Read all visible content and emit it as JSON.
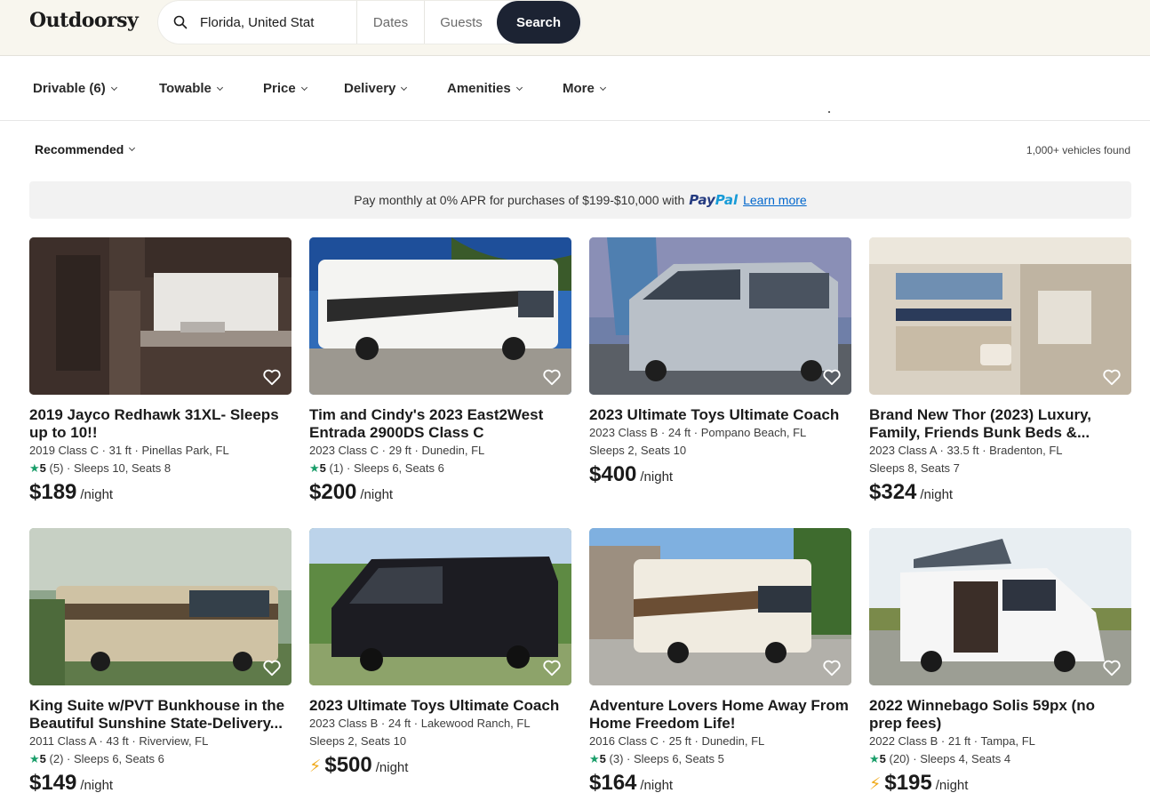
{
  "header": {
    "logo": "Outdoorsy",
    "search": {
      "location_value": "Florida, United Stat",
      "dates_label": "Dates",
      "guests_label": "Guests",
      "search_button": "Search"
    }
  },
  "filters": [
    {
      "label": "Drivable (6)"
    },
    {
      "label": "Towable"
    },
    {
      "label": "Price"
    },
    {
      "label": "Delivery"
    },
    {
      "label": "Amenities"
    },
    {
      "label": "More"
    }
  ],
  "sort": {
    "label": "Recommended",
    "count": "1,000+ vehicles found"
  },
  "banner": {
    "text": "Pay monthly at 0% APR for purchases of $199-$10,000 with",
    "paypal_a": "Pay",
    "paypal_b": "Pal",
    "learn_more": "Learn more"
  },
  "listings": [
    {
      "title": "2019 Jayco Redhawk 31XL- Sleeps up to 10!!",
      "meta": "2019 Class C · 31 ft · Pinellas Park, FL",
      "rating": "5",
      "reviews": "(5)",
      "sleeps": "Sleeps 10, Seats 8",
      "price": "$189",
      "per": "/night",
      "instant": false
    },
    {
      "title": "Tim and Cindy's 2023 East2West Entrada 2900DS Class C",
      "meta": "2023 Class C · 29 ft · Dunedin, FL",
      "rating": "5",
      "reviews": "(1)",
      "sleeps": "Sleeps 6, Seats 6",
      "price": "$200",
      "per": "/night",
      "instant": false
    },
    {
      "title": "2023 Ultimate Toys Ultimate Coach",
      "meta": "2023 Class B · 24 ft · Pompano Beach, FL",
      "rating": "",
      "reviews": "",
      "sleeps": "Sleeps 2, Seats 10",
      "price": "$400",
      "per": "/night",
      "instant": false
    },
    {
      "title": "Brand New Thor (2023) Luxury, Family, Friends Bunk Beds &...",
      "meta": "2023 Class A · 33.5 ft · Bradenton, FL",
      "rating": "",
      "reviews": "",
      "sleeps": "Sleeps 8, Seats 7",
      "price": "$324",
      "per": "/night",
      "instant": false
    },
    {
      "title": "King Suite w/PVT Bunkhouse in the Beautiful Sunshine State-Delivery...",
      "meta": "2011 Class A · 43 ft · Riverview, FL",
      "rating": "5",
      "reviews": "(2)",
      "sleeps": "Sleeps 6, Seats 6",
      "price": "$149",
      "per": "/night",
      "instant": false
    },
    {
      "title": "2023 Ultimate Toys Ultimate Coach",
      "meta": "2023 Class B · 24 ft · Lakewood Ranch, FL",
      "rating": "",
      "reviews": "",
      "sleeps": "Sleeps 2, Seats 10",
      "price": "$500",
      "per": "/night",
      "instant": true
    },
    {
      "title": "Adventure Lovers Home Away From Home Freedom Life!",
      "meta": "2016 Class C · 25 ft · Dunedin, FL",
      "rating": "5",
      "reviews": "(3)",
      "sleeps": "Sleeps 6, Seats 5",
      "price": "$164",
      "per": "/night",
      "instant": false
    },
    {
      "title": "2022 Winnebago Solis 59px (no prep fees)",
      "meta": "2022 Class B · 21 ft · Tampa, FL",
      "rating": "5",
      "reviews": "(20)",
      "sleeps": "Sleeps 4, Seats 4",
      "price": "$195",
      "per": "/night",
      "instant": true
    }
  ]
}
